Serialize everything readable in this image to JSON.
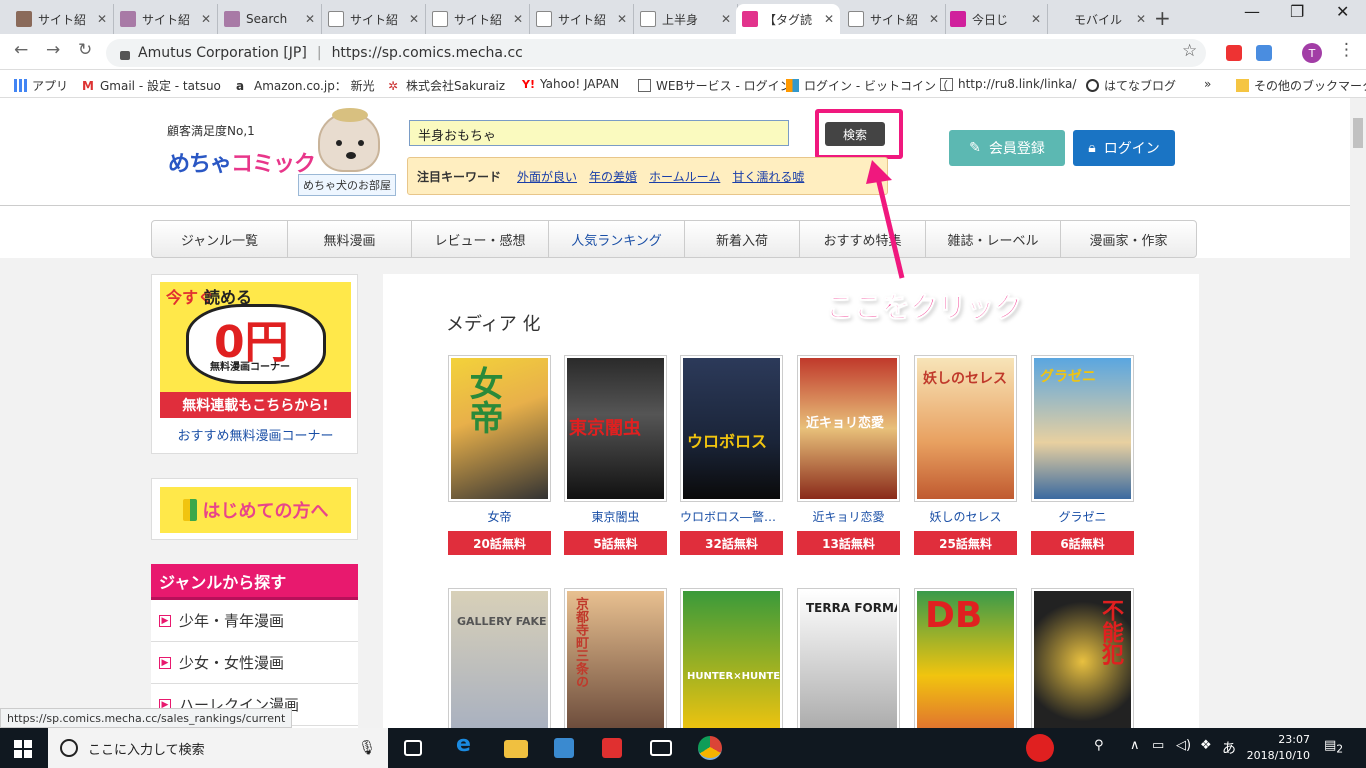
{
  "browser": {
    "tabs": [
      {
        "title": "サイト紹"
      },
      {
        "title": "サイト紹"
      },
      {
        "title": "Search"
      },
      {
        "title": "サイト紹"
      },
      {
        "title": "サイト紹"
      },
      {
        "title": "サイト紹"
      },
      {
        "title": "上半身"
      },
      {
        "title": "【タグ読"
      },
      {
        "title": "サイト紹"
      },
      {
        "title": "今日じ"
      },
      {
        "title": "モバイル"
      }
    ],
    "site_identity": "Amutus Corporation [JP]",
    "url": "https://sp.comics.mecha.cc",
    "avatar_initial": "T",
    "bookmarks": [
      {
        "label": "アプリ"
      },
      {
        "label": "Gmail - 設定 - tatsuo"
      },
      {
        "label": "Amazon.co.jp： 新光"
      },
      {
        "label": "株式会社Sakuraiz"
      },
      {
        "label": "Yahoo! JAPAN"
      },
      {
        "label": "WEBサービス - ログイン"
      },
      {
        "label": "ログイン - ビットコイン（"
      },
      {
        "label": "http://ru8.link/linka/"
      },
      {
        "label": "はてなブログ"
      },
      {
        "label": "その他のブックマーク"
      }
    ],
    "more_bookmarks": "»",
    "status_url": "https://sp.comics.mecha.cc/sales_rankings/current"
  },
  "header": {
    "tagline": "顧客満足度No,1",
    "logo_part1": "めちゃ",
    "logo_part2": "コミック",
    "dog_room": "めちゃ犬のお部屋",
    "search_value": "半身おもちゃ",
    "search_button": "検索",
    "hot_label": "注目キーワード",
    "keywords": [
      "外面が良い",
      "年の差婚",
      "ホームルーム",
      "甘く濡れる嘘"
    ],
    "signup": "会員登録",
    "login": "ログイン"
  },
  "nav": [
    {
      "label": "ジャンル一覧"
    },
    {
      "label": "無料漫画"
    },
    {
      "label": "レビュー・感想"
    },
    {
      "label": "人気ランキング"
    },
    {
      "label": "新着入荷"
    },
    {
      "label": "おすすめ特集"
    },
    {
      "label": "雑誌・レーベル"
    },
    {
      "label": "漫画家・作家"
    }
  ],
  "sidebar": {
    "free_banner": {
      "now": "今すぐ",
      "read": "読める",
      "zero_yen": "0円",
      "sub": "無料漫画コーナー",
      "banner": "無料連載もこちらから!"
    },
    "free_link": "おすすめ無料漫画コーナー",
    "first_time": "はじめての方へ",
    "genre_title": "ジャンルから探す",
    "genres": [
      "少年・青年漫画",
      "少女・女性漫画",
      "ハーレクイン漫画"
    ]
  },
  "main": {
    "section_title": "メディア 化",
    "books": [
      {
        "title": "女帝",
        "badge": "20話無料",
        "cover": "女帝"
      },
      {
        "title": "東京闇虫",
        "badge": "5話無料",
        "cover": "東京闇虫"
      },
      {
        "title": "ウロボロス―警察…",
        "badge": "32話無料",
        "cover": "ウロボロス"
      },
      {
        "title": "近キョリ恋愛",
        "badge": "13話無料",
        "cover": "近キョリ恋愛"
      },
      {
        "title": "妖しのセレス",
        "badge": "25話無料",
        "cover": "妖しのセレス"
      },
      {
        "title": "グラゼニ",
        "badge": "6話無料",
        "cover": "グラゼニ"
      }
    ],
    "books_row2": [
      {
        "cover": "GALLERY FAKE"
      },
      {
        "cover": "京都寺町三条の"
      },
      {
        "cover": "HUNTER×HUNTER"
      },
      {
        "cover": "TERRA FORMARS"
      },
      {
        "cover": "DB"
      },
      {
        "cover": "不能犯"
      }
    ]
  },
  "annotation": "ここをクリック",
  "taskbar": {
    "search_placeholder": "ここに入力して検索",
    "time": "23:07",
    "date": "2018/10/10",
    "ime": "あ",
    "notifications": "2"
  },
  "colors": {
    "accent_pink": "#f0187e",
    "badge_red": "#e02e3c",
    "link_blue": "#1a4fa6",
    "signup_teal": "#5cb8b2",
    "login_blue": "#1a74c4"
  }
}
